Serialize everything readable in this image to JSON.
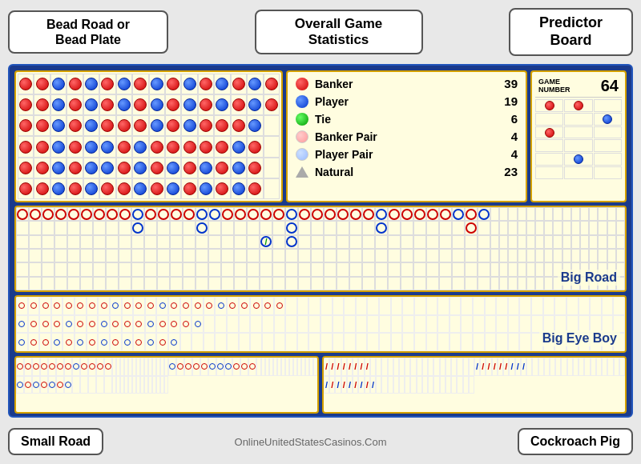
{
  "header": {
    "bead_road_label": "Bead Road or\nBead Plate",
    "overall_stats_label": "Overall Game\nStatistics",
    "predictor_label": "Predictor\nBoard"
  },
  "stats": {
    "banker": {
      "label": "Banker",
      "count": 39
    },
    "player": {
      "label": "Player",
      "count": 19
    },
    "tie": {
      "label": "Tie",
      "count": 6
    },
    "banker_pair": {
      "label": "Banker Pair",
      "count": 4
    },
    "player_pair": {
      "label": "Player Pair",
      "count": 4
    },
    "natural": {
      "label": "Natural",
      "count": 23
    }
  },
  "predictor": {
    "game_number_label": "GAME\nNUMBER",
    "game_number": 64
  },
  "section_labels": {
    "big_road": "Big Road",
    "big_eye_boy": "Big Eye Boy",
    "small_road": "Small Road",
    "cockroach_pig": "Cockroach Pig"
  },
  "footer": {
    "small_road": "Small Road",
    "watermark": "OnlineUnitedStatesCasinos.Com",
    "cockroach_pig": "Cockroach Pig"
  }
}
